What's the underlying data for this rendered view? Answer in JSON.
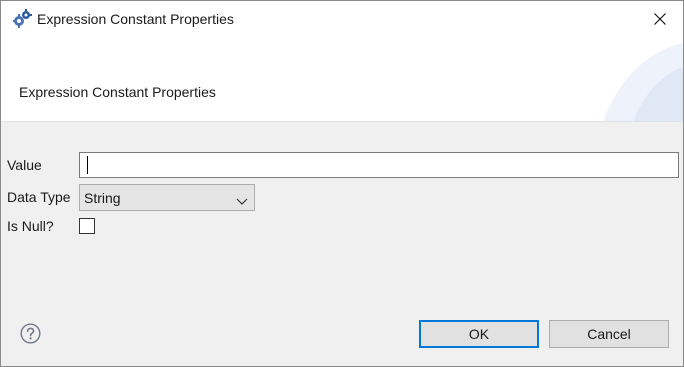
{
  "window": {
    "title": "Expression Constant Properties",
    "icon": "gears-icon",
    "close_icon": "close-icon"
  },
  "header": {
    "title": "Expression Constant Properties"
  },
  "form": {
    "value_label": "Value",
    "value_input": "",
    "data_type_label": "Data Type",
    "data_type_selected": "String",
    "is_null_label": "Is Null?",
    "is_null_checked": false
  },
  "footer": {
    "help_icon": "help-icon",
    "ok_label": "OK",
    "cancel_label": "Cancel"
  },
  "colors": {
    "accent": "#0078d7",
    "dialog_bg": "#f0f0f0",
    "banner_bg": "#ffffff"
  }
}
